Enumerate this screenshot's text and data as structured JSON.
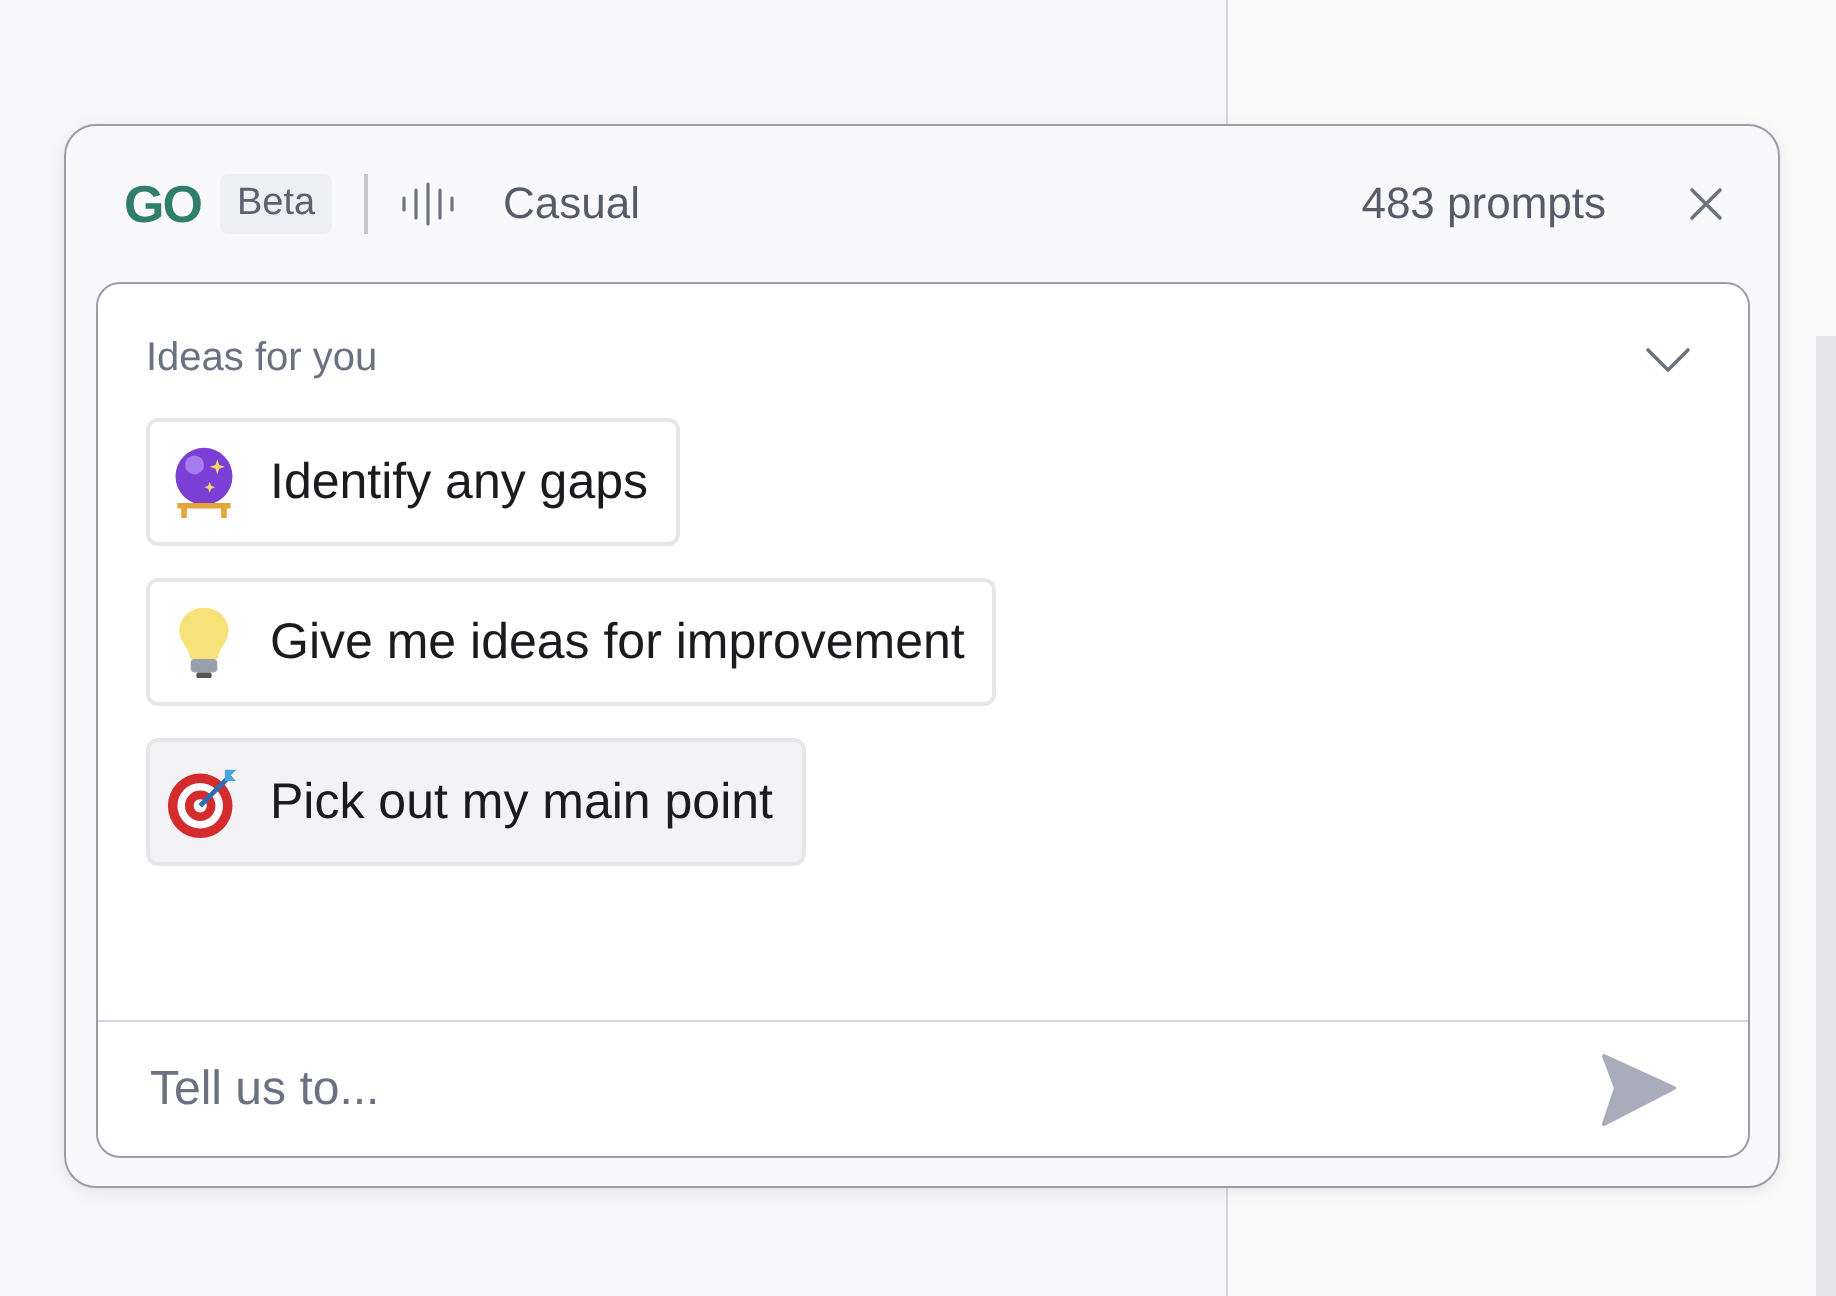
{
  "header": {
    "logo": "GO",
    "badge": "Beta",
    "tone": "Casual",
    "prompt_count": "483 prompts"
  },
  "ideas": {
    "title": "Ideas for you",
    "expanded": true,
    "items": [
      {
        "kind": "crystal-ball",
        "label": "Identify any gaps",
        "selected": false
      },
      {
        "kind": "bulb",
        "label": "Give me ideas for improvement",
        "selected": false
      },
      {
        "kind": "target",
        "label": "Pick out my main point",
        "selected": true
      }
    ]
  },
  "input": {
    "placeholder": "Tell us to..."
  }
}
